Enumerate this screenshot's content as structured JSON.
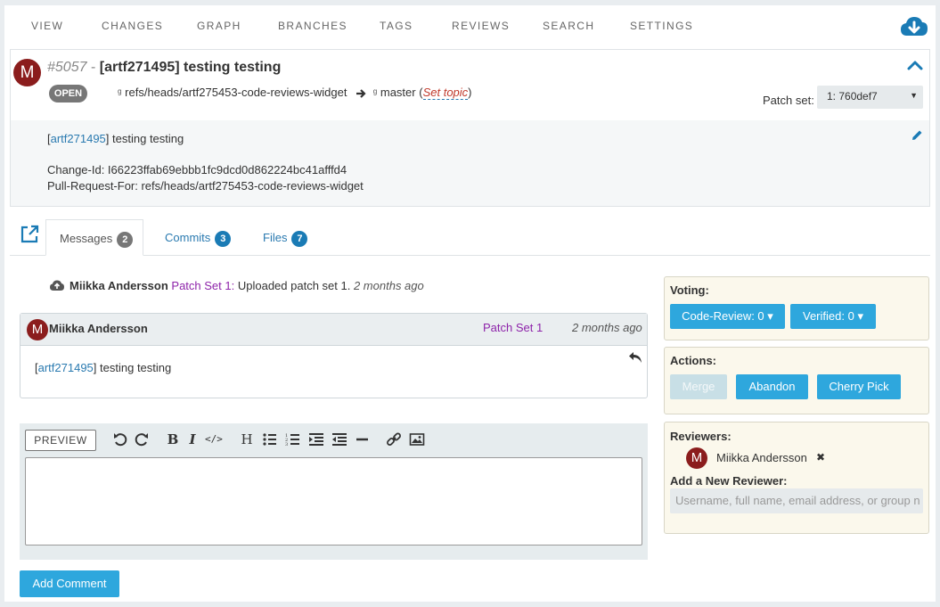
{
  "nav": {
    "items": [
      "VIEW",
      "CHANGES",
      "GRAPH",
      "BRANCHES",
      "TAGS",
      "REVIEWS",
      "SEARCH",
      "SETTINGS"
    ],
    "download_icon": "cloud-download-icon",
    "accent_color": "#1a7bb5"
  },
  "change": {
    "avatar_letter": "M",
    "number": "#5057",
    "separator": "-",
    "subject": "[artf271495] testing testing",
    "status": "OPEN",
    "source_ref": "refs/heads/artf275453-code-reviews-widget",
    "target_ref": "master",
    "topic_label": "Set topic",
    "patchset_label": "Patch set:",
    "patchset_value": "1: 760def7"
  },
  "commit_message": {
    "ref_link": "artf271495",
    "title_rest": " testing testing",
    "change_id": "Change-Id: I66223ffab69ebbb1fc9dcd0d862224bc41afffd4",
    "pull_request_for": "Pull-Request-For: refs/heads/artf275453-code-reviews-widget"
  },
  "tabs": [
    {
      "label": "Messages",
      "count": "2"
    },
    {
      "label": "Commits",
      "count": "3"
    },
    {
      "label": "Files",
      "count": "7"
    }
  ],
  "event": {
    "author": "Miikka Andersson",
    "patchset": "Patch Set 1:",
    "text": "Uploaded patch set 1.",
    "ago": "2 months ago"
  },
  "message": {
    "avatar_letter": "M",
    "author": "Miikka Andersson",
    "patchset": "Patch Set 1",
    "ago": "2 months ago",
    "ref_link": "artf271495",
    "body_rest": " testing testing"
  },
  "editor": {
    "preview_label": "PREVIEW",
    "add_comment_label": "Add Comment",
    "tools": [
      "undo-icon",
      "redo-icon",
      "bold-icon",
      "italic-icon",
      "code-icon",
      "heading-icon",
      "bullet-list-icon",
      "numbered-list-icon",
      "indent-icon",
      "outdent-icon",
      "horizontal-rule-icon",
      "link-icon",
      "image-icon"
    ]
  },
  "voting": {
    "title": "Voting:",
    "code_review": "Code-Review: 0",
    "verified": "Verified: 0"
  },
  "actions": {
    "title": "Actions:",
    "merge": "Merge",
    "abandon": "Abandon",
    "cherry_pick": "Cherry Pick"
  },
  "reviewers": {
    "title": "Reviewers:",
    "avatar_letter": "M",
    "name": "Miikka Andersson",
    "add_title": "Add a New Reviewer:",
    "placeholder": "Username, full name, email address, or group n"
  }
}
